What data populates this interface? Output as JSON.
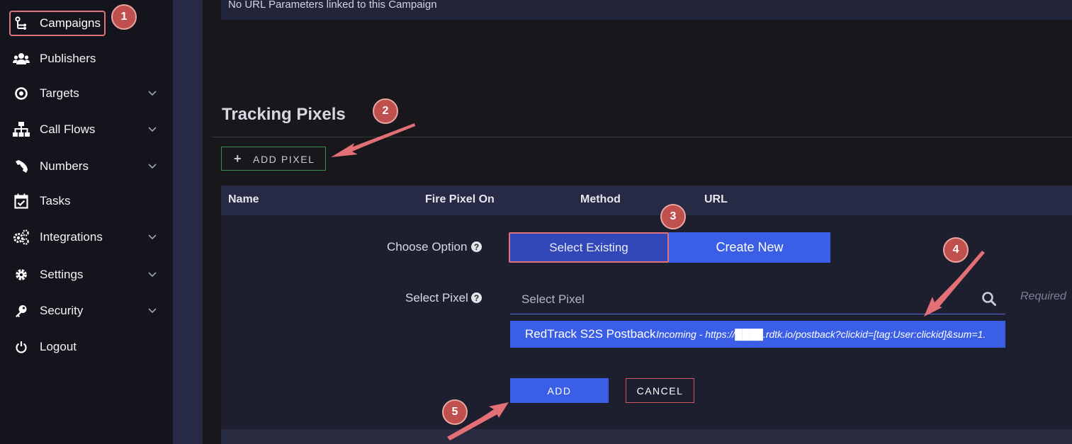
{
  "sidebar": {
    "items": [
      {
        "label": "Campaigns",
        "icon": "campaigns-icon",
        "expandable": false
      },
      {
        "label": "Publishers",
        "icon": "publishers-icon",
        "expandable": false
      },
      {
        "label": "Targets",
        "icon": "target-icon",
        "expandable": true
      },
      {
        "label": "Call Flows",
        "icon": "call-flows-icon",
        "expandable": true
      },
      {
        "label": "Numbers",
        "icon": "phone-icon",
        "expandable": true
      },
      {
        "label": "Tasks",
        "icon": "calendar-check-icon",
        "expandable": false
      },
      {
        "label": "Integrations",
        "icon": "gears-icon",
        "expandable": true
      },
      {
        "label": "Settings",
        "icon": "gear-icon",
        "expandable": true
      },
      {
        "label": "Security",
        "icon": "key-icon",
        "expandable": true
      },
      {
        "label": "Logout",
        "icon": "power-icon",
        "expandable": false
      }
    ],
    "active": "Campaigns"
  },
  "url_params": {
    "empty_text": "No URL Parameters linked to this Campaign"
  },
  "tracking_pixels": {
    "title": "Tracking Pixels",
    "add_button": "ADD PIXEL",
    "columns": [
      "Name",
      "Fire Pixel On",
      "Method",
      "URL"
    ],
    "form": {
      "choose_option_label": "Choose Option",
      "help_glyph": "?",
      "options": {
        "select_existing": "Select Existing",
        "create_new": "Create New"
      },
      "selected_option": "Select Existing",
      "select_pixel_label": "Select Pixel",
      "select_pixel_placeholder": "Select Pixel",
      "required_text": "Required",
      "dropdown_option": {
        "name": "RedTrack S2S Postback",
        "detail": "Incoming - https://████.rdtk.io/postback?clickid=[tag:User:clickid]&sum=1."
      },
      "add_button": "ADD",
      "cancel_button": "CANCEL"
    }
  },
  "annotations": [
    "1",
    "2",
    "3",
    "4",
    "5"
  ],
  "colors": {
    "accent_blue": "#3a5ee6",
    "annotation_red": "#c0504d",
    "highlight_border": "#e0727b",
    "add_pixel_border": "#3f8a54"
  }
}
